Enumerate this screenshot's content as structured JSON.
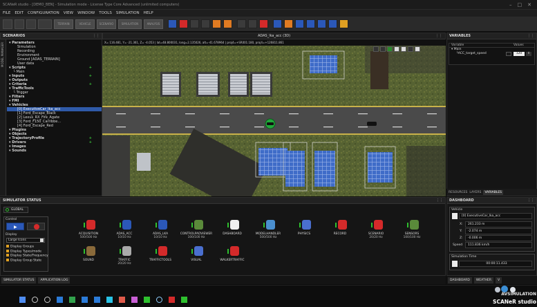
{
  "window": {
    "title": "SCANeR studio - [DEMO_BEN] - Simulation mode - License Type Core Advanced (unlimited computers)"
  },
  "menu": [
    "FILE",
    "EDIT",
    "CONFIGURATION",
    "VIEW",
    "WINDOW",
    "TOOLS",
    "SIMULATION",
    "HELP"
  ],
  "toolbar": {
    "buttons": [
      "TERRAIN",
      "VEHICLE",
      "SCENARIO",
      "SIMULATION",
      "ANALYSIS"
    ]
  },
  "scenarios": {
    "title": "SCENARIOS",
    "side_tab": "MODEL MANAGER",
    "tree": [
      {
        "label": "Parameters",
        "depth": 0,
        "bold": true
      },
      {
        "label": "Simulation",
        "depth": 2
      },
      {
        "label": "Recording",
        "depth": 2
      },
      {
        "label": "Environment",
        "depth": 2
      },
      {
        "label": "Ground [ADAS_TERRAIN]",
        "depth": 2
      },
      {
        "label": "User data",
        "depth": 2
      },
      {
        "label": "Scripts",
        "depth": 0,
        "bold": true,
        "plus": true
      },
      {
        "label": "Main",
        "depth": 1
      },
      {
        "label": "Inputs",
        "depth": 0,
        "bold": true,
        "plus": true
      },
      {
        "label": "Outputs",
        "depth": 0,
        "bold": true
      },
      {
        "label": "Criteria",
        "depth": 0,
        "bold": true,
        "plus": true
      },
      {
        "label": "TrafficTools",
        "depth": 0,
        "bold": true
      },
      {
        "label": "Trigger",
        "depth": 1
      },
      {
        "label": "Filters",
        "depth": 0,
        "bold": true
      },
      {
        "label": "FMI",
        "depth": 0,
        "bold": true
      },
      {
        "label": "Vehicles",
        "depth": 0,
        "bold": true
      },
      {
        "label": "[0] ExecutiveCar_lka_acc",
        "depth": 2,
        "selected": true
      },
      {
        "label": "[1] Ford_Escape_Black",
        "depth": 2
      },
      {
        "label": "[2] Lexus_RX_Fire_Agate",
        "depth": 2
      },
      {
        "label": "[3] Ford_F150_Carribbe...",
        "depth": 2
      },
      {
        "label": "[4] Ford_Escape_Red",
        "depth": 2
      },
      {
        "label": "Plugins",
        "depth": 0,
        "bold": true
      },
      {
        "label": "Objects",
        "depth": 0,
        "bold": true
      },
      {
        "label": "TrajectoryProfile",
        "depth": 0,
        "bold": true,
        "plus": true
      },
      {
        "label": "Drivers",
        "depth": 0,
        "bold": true,
        "plus": true
      },
      {
        "label": "Images",
        "depth": 0,
        "bold": true
      },
      {
        "label": "Sounds",
        "depth": 0,
        "bold": true
      }
    ]
  },
  "viewport": {
    "title": "ADAS_lka_acc (3D)",
    "info": "X= 116.481, Y= -21.361, Z= -4.053 | lat=48.800031, long=2.135026, alt=-41.678964 | proj4=+SR001.180, proj4=+126811.861"
  },
  "variables": {
    "title": "VARIABLES",
    "col_variable": "Variable",
    "col_value": "Values",
    "group": "Main",
    "var_name": "ACC_target_speed",
    "var_value": "120",
    "tabs": [
      "RESOURCES",
      "LAYERS",
      "VARIABLES"
    ]
  },
  "simstatus": {
    "title": "SIMULATOR STATUS",
    "global": "GLOBAL",
    "control_label": "Control",
    "display_label": "Display",
    "display_select": "Large Icons",
    "checks": [
      "Display Groups",
      "Display Types/mode",
      "Display State/Frequency",
      "Display Group State"
    ],
    "modules_row1": [
      {
        "name": "ACQUISITION",
        "status": "500/500 Hz"
      },
      {
        "name": "ADAS_ACC",
        "status": "10/10 Hz"
      },
      {
        "name": "ADAS_LKA",
        "status": "10/10 Hz"
      },
      {
        "name": "CONTROLPADVIEWER",
        "status": "100/100 Hz"
      },
      {
        "name": "DASHBOARD",
        "status": ""
      },
      {
        "name": "MODELHANDLER",
        "status": "500/500 Hz"
      },
      {
        "name": "PHYSICS",
        "status": ""
      },
      {
        "name": "RECORD",
        "status": ""
      },
      {
        "name": "SCENARIO",
        "status": "20/20 Hz"
      },
      {
        "name": "SENSORS",
        "status": "100/100 Hz"
      }
    ],
    "modules_row2": [
      {
        "name": "SOUND",
        "status": ""
      },
      {
        "name": "TRAFFIC",
        "status": "20/20 Hz"
      },
      {
        "name": "TRAFFICTOOLS",
        "status": ""
      },
      {
        "name": "VISUAL",
        "status": ""
      },
      {
        "name": "WALKERTRAFFIC",
        "status": ""
      }
    ],
    "tabs": [
      "SIMULATOR STATUS",
      "APPLICATION LOG"
    ]
  },
  "dashboard": {
    "title": "DASHBOARD",
    "vehicle_label": "Vehicle",
    "vehicle_value": "[0] ExecutiveCar_lka_acc",
    "x_label": "X:",
    "x_value": "261.233 m",
    "y_label": "Y:",
    "y_value": "-2.074 m",
    "z_label": "Z:",
    "z_value": "-0.006 m",
    "speed_label": "Speed",
    "speed_value": "111.836 km/h",
    "simtime_label": "Simulation Time",
    "simtime_value": "00:00:11.433",
    "tabs": [
      "DASHBOARD",
      "WEATHER",
      "V"
    ]
  },
  "brand": {
    "line1": "AVSIMULATION",
    "line2": "SCANeR studio"
  },
  "colors": {
    "accent_blue": "#2f5aa8",
    "green": "#2ec02e",
    "red": "#d42a2a",
    "road": "#4a4a4a"
  }
}
